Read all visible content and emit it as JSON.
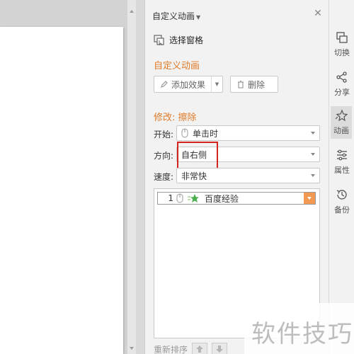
{
  "panel": {
    "title": "自定义动画",
    "select_pane_label": "选择窗格",
    "section_title": "自定义动画",
    "add_effect_label": "添加效果",
    "delete_label": "删除",
    "modify_title": "修改: 擦除",
    "start_label": "开始:",
    "start_value": "单击时",
    "direction_label": "方向:",
    "direction_value": "自右侧",
    "speed_label": "速度:",
    "speed_value": "非常快",
    "animation_list": [
      {
        "index": "1",
        "name": "百度经验"
      }
    ],
    "reorder_label": "重新排序"
  },
  "sidebar": {
    "items": [
      {
        "label": "切换",
        "icon": "switch-icon"
      },
      {
        "label": "分享",
        "icon": "share-icon"
      },
      {
        "label": "动画",
        "icon": "animation-icon",
        "active": true
      },
      {
        "label": "属性",
        "icon": "properties-icon"
      },
      {
        "label": "备份",
        "icon": "backup-icon"
      }
    ]
  },
  "watermark": {
    "text": "软件技巧"
  },
  "colors": {
    "accent": "#e07b2a",
    "highlight": "#d6231f"
  }
}
